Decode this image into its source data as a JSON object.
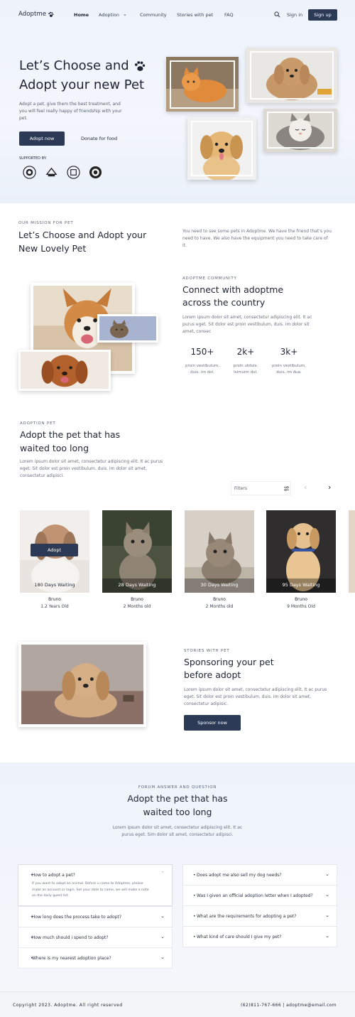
{
  "nav": {
    "logo": "Adoptme",
    "links": [
      "Home",
      "Adoption",
      "Community",
      "Stories with pet",
      "FAQ"
    ],
    "signin": "Sign in",
    "signup": "Sign up"
  },
  "hero": {
    "title_line1": "Let’s Choose and",
    "title_line2": "Adopt your new Pet",
    "desc": "Adopt a pet, give them the best treatment, and you will feel really happy of friendship with your pet.",
    "primary": "Adopt now",
    "secondary": "Donate for food",
    "supported": "SUPPORTED BY:"
  },
  "mission": {
    "label": "OUR MISSION FOR PET",
    "title_line1": "Let’s Choose and Adopt your",
    "title_line2": "New Lovely Pet",
    "text": "You need to see some pets in Adoptme. We have the friend that's you need to have. We also have the equipment you need to take care of it."
  },
  "community": {
    "label": "ADOPTME COMMUNITY",
    "title_line1": "Connect with adoptme",
    "title_line2": "across the country",
    "text": "Lorem ipsum dolor sit amet, consectetur adipiscing elit. It ac purus eget. Sit dolor est proin vestibulum, duis. im dolor sit amet, consec",
    "stats": [
      {
        "num": "150+",
        "l1": "proin vestibulum,",
        "l2": "duis. im dol."
      },
      {
        "num": "2k+",
        "l1": "proin utduis.",
        "l2": "Isimuim dol."
      },
      {
        "num": "3k+",
        "l1": "proin vestibulum,",
        "l2": "duis. im dua."
      }
    ]
  },
  "adoption": {
    "label": "ADOPTION PET",
    "title_line1": "Adopt the pet that has",
    "title_line2": "waited too long",
    "text": "Lorem ipsum dolor sit amet, consectetur adipiscing elit. It ac purus eget. Sit dolor est proin vestibulum, duis. im dolor sit amet, consectetur adipisci.",
    "filters": "Filters",
    "adopt_button": "Adopt",
    "pets": [
      {
        "wait": "180 Days Waiting",
        "name": "Bruno",
        "age": "1.2 Years Old"
      },
      {
        "wait": "28 Days Waiting",
        "name": "Bruno",
        "age": "2 Months old"
      },
      {
        "wait": "30 Days Waiting",
        "name": "Bruno",
        "age": "2 Months old"
      },
      {
        "wait": "95 Days Waiting",
        "name": "Bruno",
        "age": "9 Months Old"
      }
    ]
  },
  "stories": {
    "label": "STORIES WITH PET",
    "title_line1": "Sponsoring your pet",
    "title_line2": "before adopt",
    "text": "Lorem ipsum dolor sit amet, consectetur adipiscing elit. It ac purus eget. Sit dolor est proin vestibulum, duis. im dolor sit amet, consectetur adipisic.",
    "button": "Sponsor now"
  },
  "forum": {
    "label": "FORUM ANSWER AND QUESTION",
    "title_line1": "Adopt the pet that has",
    "title_line2": "waited too long",
    "text": "Lorem ipsum dolor sit amet, consectetur adipiscing elit. It ac purus eget. Sim dolor sit amet, consectetur adipisci.",
    "left": [
      {
        "q": "How to adopt a pet?",
        "a": "If you want to adopt an animal. Before u came to Adoptme, please make an account or login. Set your date to came, we will make a note on the daily guest list."
      },
      {
        "q": "How long does the process take to adopt?"
      },
      {
        "q": "How much should i spend to adopt?"
      },
      {
        "q": "Where is my nearest adoption place?"
      }
    ],
    "right": [
      {
        "q": "Does adopt me also sell my dog needs?"
      },
      {
        "q": "Was I given an official adoption letter when I adopted?"
      },
      {
        "q": "What are the requirements for adopting a pet?"
      },
      {
        "q": "What kind of care should I give my pet?"
      }
    ]
  },
  "footer": {
    "copyright": "Copyright 2023. Adoptme. All right reserved",
    "contact": "(62)811-767-666 | adoptme@email.com"
  },
  "colors": {
    "primary": "#2d3a55",
    "bg_soft": "#eef3fb"
  }
}
